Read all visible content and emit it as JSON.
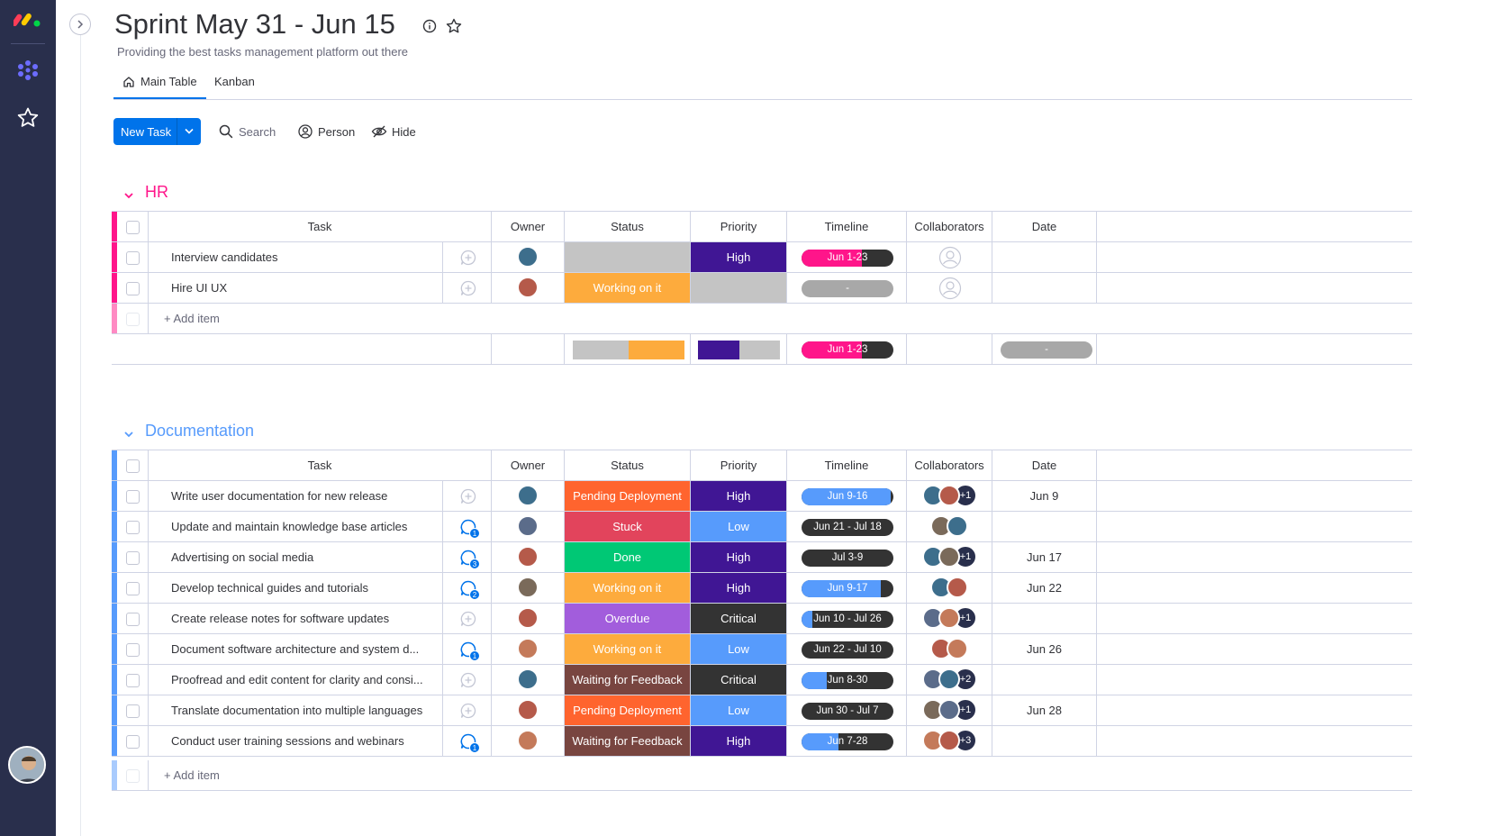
{
  "board": {
    "title": "Sprint May 31 - Jun 15",
    "subtitle": "Providing the best tasks management platform out there",
    "tabs": [
      {
        "label": "Main Table"
      },
      {
        "label": "Kanban"
      }
    ]
  },
  "toolbar": {
    "new_task": "New Task",
    "search": "Search",
    "person": "Person",
    "hide": "Hide"
  },
  "columns": {
    "task": "Task",
    "owner": "Owner",
    "status": "Status",
    "priority": "Priority",
    "timeline": "Timeline",
    "collaborators": "Collaborators",
    "date": "Date"
  },
  "add_item": "+ Add item",
  "colors": {
    "accent": "#0073ea",
    "nav_bg": "#292f4c",
    "hr_group": "#ff158a",
    "doc_group": "#579bfc",
    "working_on_it": "#fdab3d",
    "stuck": "#e2445c",
    "done": "#00c875",
    "pending_deployment": "#ff642e",
    "overdue": "#a25ddc",
    "waiting": "#784540",
    "high": "#401694",
    "low": "#579bfc",
    "critical": "#333333",
    "empty": "#c4c4c4"
  },
  "groups": {
    "hr": {
      "name": "HR",
      "rows": [
        {
          "task": "Interview candidates",
          "status": "",
          "priority": "High",
          "timeline": "Jun 1-23",
          "updates": 0,
          "date": ""
        },
        {
          "task": "Hire UI UX",
          "status": "Working on it",
          "priority": "",
          "timeline": "-",
          "updates": 0,
          "date": ""
        }
      ],
      "summary": {
        "timeline": "Jun 1-23",
        "date": "-"
      }
    },
    "documentation": {
      "name": "Documentation",
      "rows": [
        {
          "task": "Write user documentation for new release",
          "status": "Pending Deployment",
          "priority": "High",
          "timeline": "Jun 9-16",
          "updates": 0,
          "collab_more": "+1",
          "date": "Jun 9"
        },
        {
          "task": "Update and maintain knowledge base articles",
          "status": "Stuck",
          "priority": "Low",
          "timeline": "Jun 21 - Jul 18",
          "updates": 1,
          "collab_more": "",
          "date": ""
        },
        {
          "task": "Advertising on social media",
          "status": "Done",
          "priority": "High",
          "timeline": "Jul 3-9",
          "updates": 3,
          "collab_more": "+1",
          "date": "Jun 17"
        },
        {
          "task": "Develop technical guides and tutorials",
          "status": "Working on it",
          "priority": "High",
          "timeline": "Jun 9-17",
          "updates": 2,
          "collab_more": "",
          "date": "Jun 22"
        },
        {
          "task": "Create release notes for software updates",
          "status": "Overdue",
          "priority": "Critical",
          "timeline": "Jun 10 - Jul 26",
          "updates": 0,
          "collab_more": "+1",
          "date": ""
        },
        {
          "task": "Document software architecture and system d...",
          "status": "Working on it",
          "priority": "Low",
          "timeline": "Jun 22 - Jul 10",
          "updates": 1,
          "collab_more": "",
          "date": "Jun 26"
        },
        {
          "task": "Proofread and edit content for clarity and consi...",
          "status": "Waiting for Feedback",
          "priority": "Critical",
          "timeline": "Jun 8-30",
          "updates": 0,
          "collab_more": "+2",
          "date": ""
        },
        {
          "task": "Translate documentation into multiple languages",
          "status": "Pending Deployment",
          "priority": "Low",
          "timeline": "Jun 30 - Jul 7",
          "updates": 0,
          "collab_more": "+1",
          "date": "Jun 28"
        },
        {
          "task": "Conduct user training sessions and webinars",
          "status": "Waiting for Feedback",
          "priority": "High",
          "timeline": "Jun 7-28",
          "updates": 1,
          "collab_more": "+3",
          "date": ""
        }
      ]
    }
  }
}
